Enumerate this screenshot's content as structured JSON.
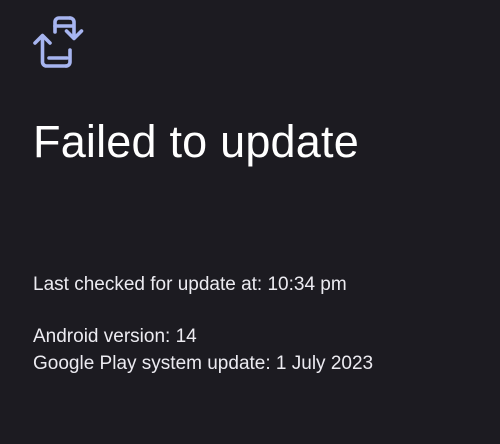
{
  "icon": "system-update-icon",
  "accent_color": "#a7b5f0",
  "background_color": "#1c1b21",
  "title": "Failed to update",
  "last_checked": "Last checked for update at: 10:34 pm",
  "android_version": "Android version: 14",
  "play_system_update": "Google Play system update: 1 July 2023"
}
